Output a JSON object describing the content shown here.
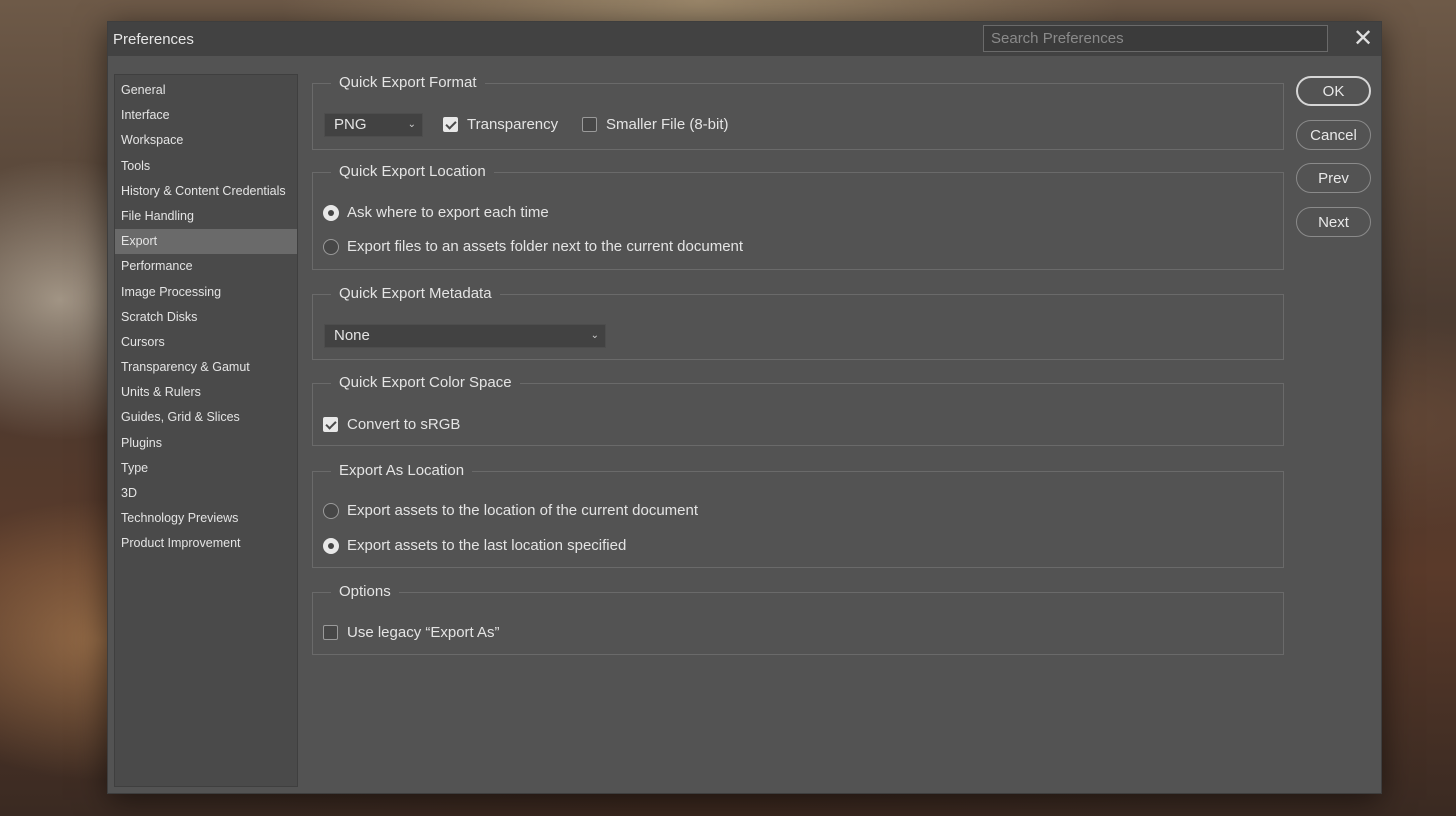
{
  "window": {
    "title": "Preferences",
    "search_placeholder": "Search Preferences",
    "close_glyph": "✕"
  },
  "sidebar": {
    "items": [
      {
        "label": "General"
      },
      {
        "label": "Interface"
      },
      {
        "label": "Workspace"
      },
      {
        "label": "Tools"
      },
      {
        "label": "History & Content Credentials"
      },
      {
        "label": "File Handling"
      },
      {
        "label": "Export",
        "active": true
      },
      {
        "label": "Performance"
      },
      {
        "label": "Image Processing"
      },
      {
        "label": "Scratch Disks"
      },
      {
        "label": "Cursors"
      },
      {
        "label": "Transparency & Gamut"
      },
      {
        "label": "Units & Rulers"
      },
      {
        "label": "Guides, Grid & Slices"
      },
      {
        "label": "Plugins"
      },
      {
        "label": "Type"
      },
      {
        "label": "3D"
      },
      {
        "label": "Technology Previews"
      },
      {
        "label": "Product Improvement"
      }
    ]
  },
  "quick_export_format": {
    "legend": "Quick Export Format",
    "format_value": "PNG",
    "transparency": {
      "label": "Transparency",
      "checked": true
    },
    "smaller_file": {
      "label": "Smaller File (8-bit)",
      "checked": false
    }
  },
  "quick_export_location": {
    "legend": "Quick Export Location",
    "ask_each_time": {
      "label": "Ask where to export each time",
      "selected": true
    },
    "assets_folder": {
      "label": "Export files to an assets folder next to the current document",
      "selected": false
    }
  },
  "quick_export_metadata": {
    "legend": "Quick Export Metadata",
    "value": "None"
  },
  "quick_export_color_space": {
    "legend": "Quick Export Color Space",
    "convert_srgb": {
      "label": "Convert to sRGB",
      "checked": true
    }
  },
  "export_as_location": {
    "legend": "Export As Location",
    "current_doc": {
      "label": "Export assets to the location of the current document",
      "selected": false
    },
    "last_location": {
      "label": "Export assets to the last location specified",
      "selected": true
    }
  },
  "options": {
    "legend": "Options",
    "legacy_export": {
      "label": "Use legacy “Export As”",
      "checked": false
    }
  },
  "buttons": {
    "ok": "OK",
    "cancel": "Cancel",
    "prev": "Prev",
    "next": "Next"
  },
  "chevron_glyph": "⌄"
}
